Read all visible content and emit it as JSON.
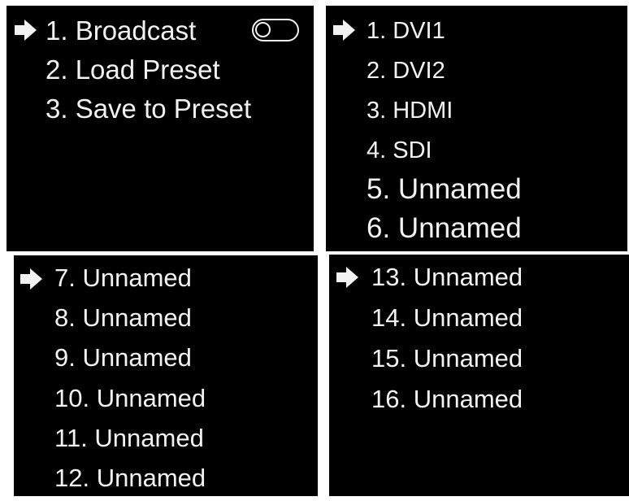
{
  "panels": [
    {
      "id": "main-menu",
      "items": [
        {
          "label": "1. Broadcast",
          "selected": true,
          "toggle": {
            "on": false
          }
        },
        {
          "label": "2. Load Preset"
        },
        {
          "label": "3. Save to Preset"
        }
      ]
    },
    {
      "id": "preset-page-1",
      "items": [
        {
          "label": "1. DVI1",
          "selected": true
        },
        {
          "label": "2. DVI2"
        },
        {
          "label": "3. HDMI"
        },
        {
          "label": "4. SDI"
        },
        {
          "label": "5. Unnamed"
        },
        {
          "label": "6. Unnamed"
        }
      ]
    },
    {
      "id": "preset-page-2",
      "items": [
        {
          "label": "7. Unnamed",
          "selected": true
        },
        {
          "label": "8. Unnamed"
        },
        {
          "label": "9. Unnamed"
        },
        {
          "label": "10. Unnamed"
        },
        {
          "label": "11. Unnamed"
        },
        {
          "label": "12. Unnamed"
        }
      ]
    },
    {
      "id": "preset-page-3",
      "items": [
        {
          "label": "13. Unnamed",
          "selected": true
        },
        {
          "label": "14. Unnamed"
        },
        {
          "label": "15. Unnamed"
        },
        {
          "label": "16. Unnamed"
        }
      ]
    }
  ],
  "colors": {
    "screen_bg": "#000000",
    "text": "#f2f2f2",
    "divider": "#ffffff"
  },
  "icons": {
    "pointer": "arrow-right-icon",
    "toggle": "toggle-switch-icon"
  }
}
